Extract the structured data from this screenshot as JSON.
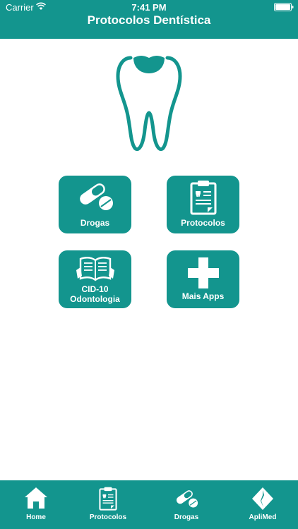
{
  "status_bar": {
    "carrier": "Carrier",
    "time": "7:41 PM"
  },
  "header": {
    "title": "Protocolos Dentística"
  },
  "logo": {
    "icon": "tooth-icon"
  },
  "tiles": [
    {
      "label": "Drogas",
      "icon": "pills-icon"
    },
    {
      "label": "Protocolos",
      "icon": "clipboard-icon"
    },
    {
      "label_line1": "CID-10",
      "label_line2": "Odontologia",
      "icon": "open-book-icon"
    },
    {
      "label": "Mais Apps",
      "icon": "plus-icon"
    }
  ],
  "tabbar": {
    "items": [
      {
        "label": "Home",
        "icon": "home-icon"
      },
      {
        "label": "Protocolos",
        "icon": "clipboard-icon"
      },
      {
        "label": "Drogas",
        "icon": "pills-icon"
      },
      {
        "label": "ApliMed",
        "icon": "aplimed-logo-icon"
      }
    ]
  },
  "colors": {
    "primary": "#13958e",
    "background": "#ffffff",
    "text_on_primary": "#ffffff"
  }
}
